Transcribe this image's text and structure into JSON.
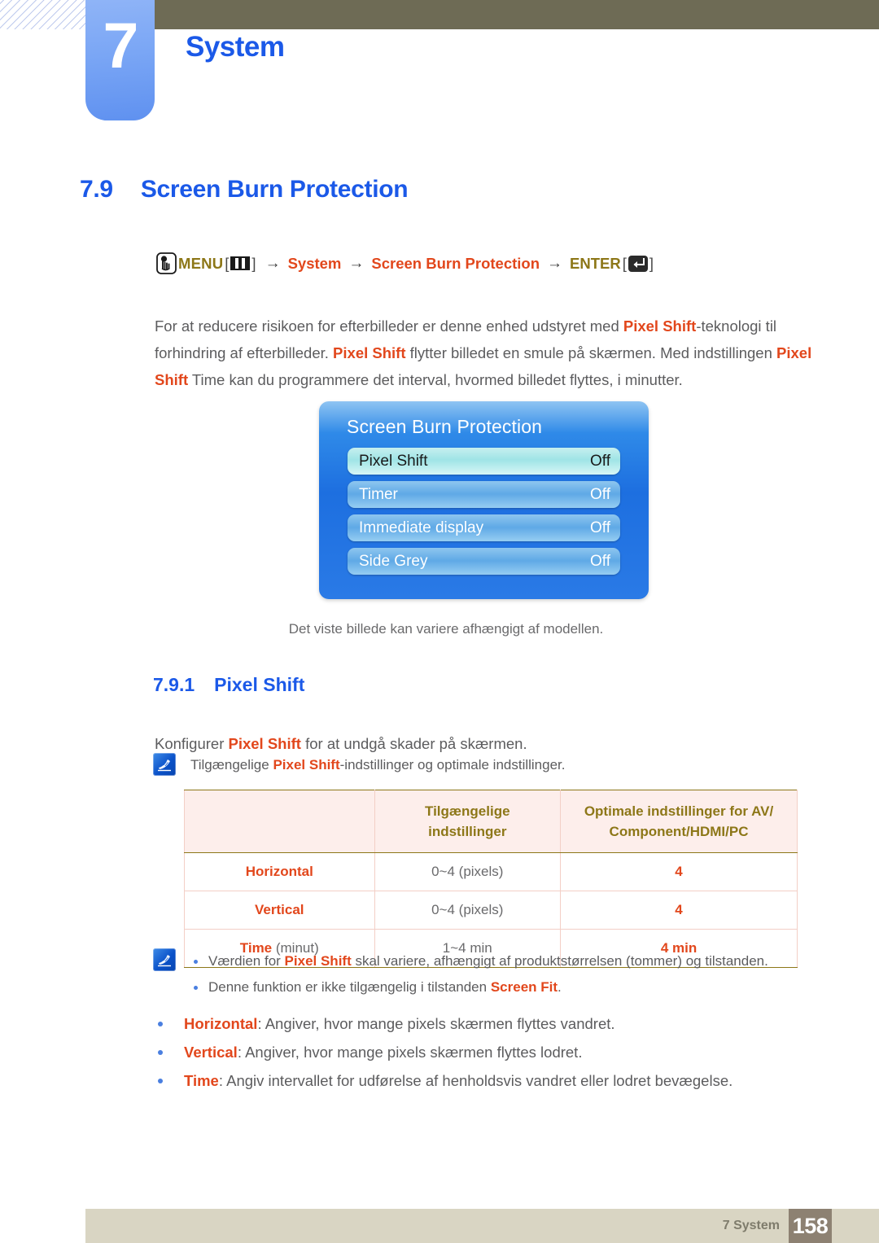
{
  "header": {
    "chapter_number": "7",
    "chapter_title": "System"
  },
  "section": {
    "number": "7.9",
    "title": "Screen Burn Protection"
  },
  "breadcrumb": {
    "hand_icon": "hand-press-icon",
    "menu_label": "MENU",
    "bracket_open": "[",
    "bracket_close": "]",
    "menu_key_icon": "menu-key-icon",
    "arrow": "→",
    "path_1": "System",
    "path_2": "Screen Burn Protection",
    "enter_label": "ENTER",
    "enter_key_icon": "enter-key-icon"
  },
  "intro": {
    "part_1": "For at reducere risikoen for efterbilleder er denne enhed udstyret med ",
    "hl_1": "Pixel Shift",
    "part_2": "-teknologi til forhindring af efterbilleder. ",
    "hl_2": "Pixel Shift",
    "part_3": " flytter billedet en smule på skærmen. Med indstillingen ",
    "hl_3": "Pixel Shift",
    "part_4": " Time kan du programmere det interval, hvormed billedet flyttes, i minutter."
  },
  "osd": {
    "title": "Screen Burn Protection",
    "rows": [
      {
        "label": "Pixel Shift",
        "value": "Off",
        "selected": true
      },
      {
        "label": "Timer",
        "value": "Off",
        "selected": false
      },
      {
        "label": "Immediate display",
        "value": "Off",
        "selected": false
      },
      {
        "label": "Side Grey",
        "value": "Off",
        "selected": false
      }
    ]
  },
  "osd_caption": "Det viste billede kan variere afhængigt af modellen.",
  "subsection": {
    "number": "7.9.1",
    "title": "Pixel Shift"
  },
  "sub_paragraph": {
    "part_1": "Konfigurer ",
    "hl_1": "Pixel Shift",
    "part_2": " for at undgå skader på skærmen."
  },
  "note_1": {
    "icon": "note-pen-icon",
    "part_1": "Tilgængelige ",
    "hl_1": "Pixel Shift",
    "part_2": "-indstillinger og optimale indstillinger."
  },
  "table": {
    "headers": [
      "",
      "Tilgængelige indstillinger",
      "Optimale indstillinger for AV/ Component/HDMI/PC"
    ],
    "header_line1": [
      "",
      "Tilgængelige",
      "Optimale indstillinger for AV/"
    ],
    "header_line2": [
      "",
      "indstillinger",
      "Component/HDMI/PC"
    ],
    "rows": [
      {
        "label": "Horizontal",
        "label_unit": "",
        "available": "0~4 (pixels)",
        "optimal": "4"
      },
      {
        "label": "Vertical",
        "label_unit": "",
        "available": "0~4 (pixels)",
        "optimal": "4"
      },
      {
        "label": "Time",
        "label_unit": " (minut)",
        "available": "1~4 min",
        "optimal": "4 min"
      }
    ]
  },
  "note_2": {
    "icon": "note-pen-icon",
    "items": [
      {
        "part_1": "Værdien for ",
        "hl_1": "Pixel Shift",
        "part_2": " skal variere, afhængigt af produktstørrelsen (tommer) og tilstanden."
      },
      {
        "part_1": "Denne funktion er ikke tilgængelig i tilstanden ",
        "hl_1": "Screen Fit",
        "part_2": "."
      }
    ]
  },
  "final_bullets": [
    {
      "hl_1": "Horizontal",
      "part_2": ": Angiver, hvor mange pixels skærmen flyttes vandret."
    },
    {
      "hl_1": "Vertical",
      "part_2": ": Angiver, hvor mange pixels skærmen flyttes lodret."
    },
    {
      "hl_1": "Time",
      "part_2": ": Angiv intervallet for udførelse af henholdsvis vandret eller lodret bevægelse."
    }
  ],
  "footer": {
    "label": "7 System",
    "page": "158"
  },
  "colors": {
    "brand_blue": "#1b59e8",
    "accent_orange": "#e2471c",
    "olive": "#8d7718",
    "header_band": "#6e6b55",
    "footer_band": "#d9d5c3",
    "page_box": "#8d8172"
  }
}
